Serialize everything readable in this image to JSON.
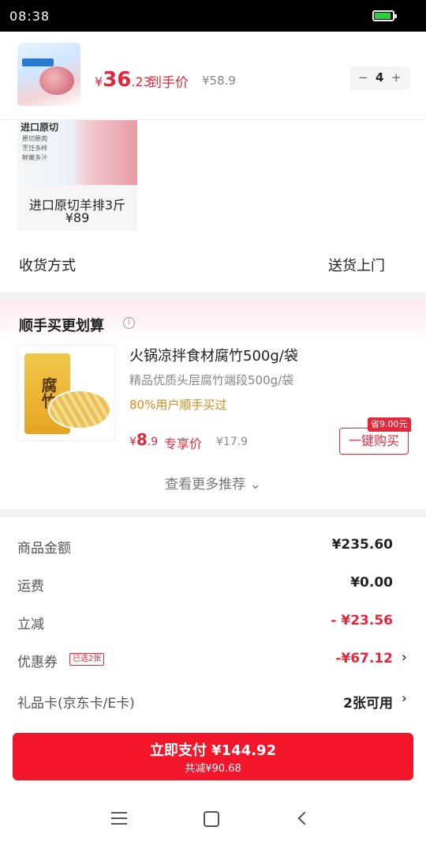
{
  "status": {
    "time": "08:38"
  },
  "product": {
    "price_symbol": "¥",
    "price_int": "36",
    "price_dec": ".23",
    "price_label": "到手价",
    "original_price": "¥58.9",
    "quantity": "4",
    "minus": "−",
    "plus": "+"
  },
  "gift": {
    "img_title": "进口原切",
    "img_lines": [
      "原切原肉",
      "烹饪多样",
      "鲜嫩多汁"
    ],
    "name": "进口原切羊排3斤",
    "price": "¥89"
  },
  "delivery": {
    "label": "收货方式",
    "value": "送货上门"
  },
  "recommend": {
    "title": "顺手买更划算",
    "info_icon": "i",
    "bag_text": "腐竹",
    "item_name": "火锅凉拌食材腐竹500g/袋",
    "item_sub": "精品优质头层腐竹端段500g/袋",
    "item_tag": "80%用户顺手买过",
    "price_symbol": "¥",
    "price_int": "8",
    "price_dec": ".9",
    "price_label": "专享价",
    "original_price": "¥17.9",
    "save_badge": "省9.00元",
    "buy_button": "一键购买",
    "see_more": "查看更多推荐 ⌄"
  },
  "summary": {
    "goods_label": "商品金额",
    "goods_value": "¥235.60",
    "shipping_label": "运费",
    "shipping_value": "¥0.00",
    "discount_label": "立减",
    "discount_value": "- ¥23.56",
    "coupon_label": "优惠券",
    "coupon_badge": "已选2张",
    "coupon_value": "-¥67.12",
    "giftcard_label": "礼品卡(京东卡/E卡)",
    "giftcard_value": "2张可用",
    "chevron": "›"
  },
  "pay": {
    "main": "立即支付 ¥144.92",
    "sub": "共减¥90.68"
  },
  "colors": {
    "accent": "#e4283b",
    "button": "#f3162a",
    "tag": "#d98a1a"
  },
  "icons": [
    "battery-icon",
    "info-icon",
    "chevron-right-icon",
    "menu-icon",
    "home-icon",
    "back-icon"
  ]
}
